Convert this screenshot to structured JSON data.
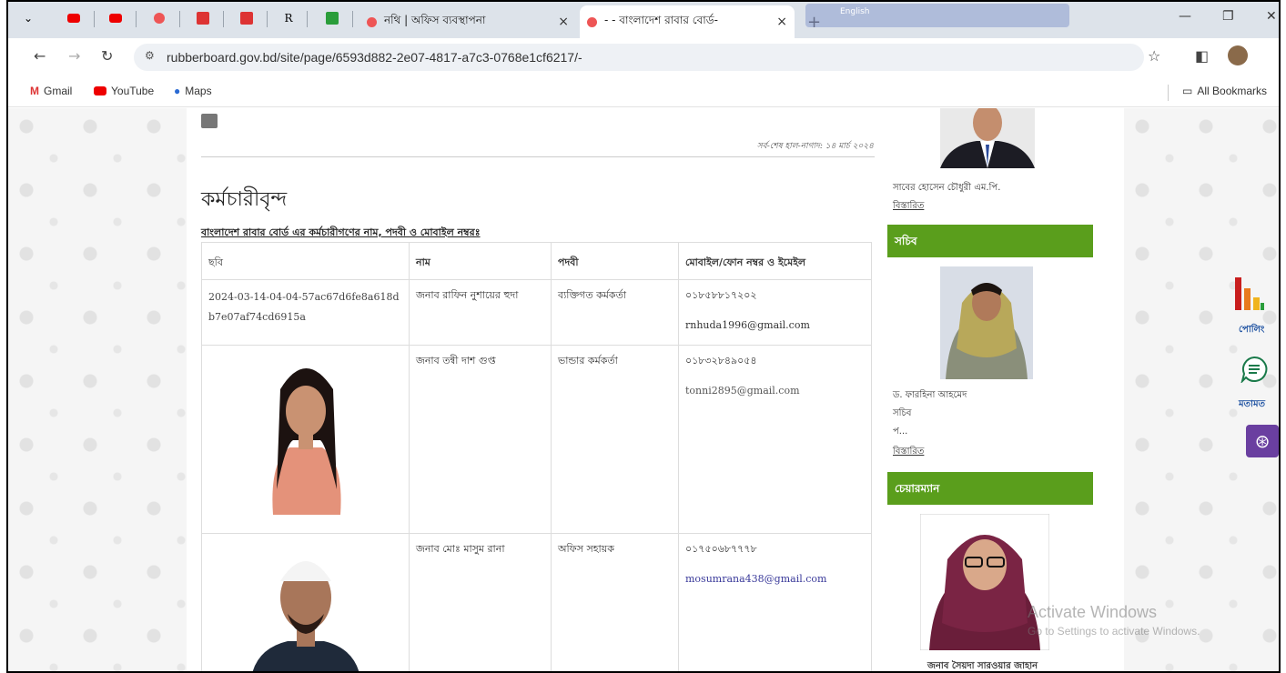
{
  "browser": {
    "tabs": [
      {
        "title": "নথি | অফিস ব্যবস্থাপনা"
      },
      {
        "title": "- - বাংলাদেশ রাবার বোর্ড-"
      }
    ],
    "lang_ext": "English",
    "url": "rubberboard.gov.bd/site/page/6593d882-2e07-4817-a7c3-0768e1cf6217/-",
    "bookmarks": [
      "Gmail",
      "YouTube",
      "Maps"
    ],
    "all_bookmarks": "All Bookmarks"
  },
  "page": {
    "updated": "সর্ব-শেষ হাল-নাগাদ: ১৪ মার্চ ২০২৪",
    "title": "কর্মচারীবৃন্দ",
    "subtitle": "বাংলাদেশ রাবার বোর্ড এর কর্মচারীগণের নাম, পদবী ও মোবাইল নম্বরঃ",
    "table": {
      "headers": [
        "ছবি",
        "নাম",
        "পদবী",
        "মোবাইল/ফোন নম্বর ও ইমেইল"
      ],
      "rows": [
        {
          "photo_alt": "2024-03-14-04-04-57ac67d6fe8a618db7e07af74cd6915a",
          "name": "জনাব রাফিন নুশায়ের হুদা",
          "designation": "ব্যক্তিগত কর্মকর্তা",
          "phone": "০১৮৫৮৮১৭২০২",
          "email": "rnhuda1996@gmail.com"
        },
        {
          "photo_alt": "",
          "name": "জনাব তন্বী দাশ গুপ্ত",
          "designation": "ভান্ডার কর্মকর্তা",
          "phone": "০১৮৩২৮৪৯০৫৪",
          "email": "tonni2895@gmail.com"
        },
        {
          "photo_alt": "",
          "name": "জনাব মোঃ মাসুম রানা",
          "designation": "অফিস সহায়ক",
          "phone": "০১৭৫০৬৮৭৭৭৮",
          "email": "mosumrana438@gmail.com"
        }
      ]
    }
  },
  "sidebar": {
    "minister_name": "সাবের হোসেন চৌধুরী এম.পি.",
    "more1": "বিস্তারিত",
    "secretary_heading": "সচিব",
    "secretary_name": "ড. ফারহিনা আহমেদ",
    "secretary_role": "সচিব",
    "secretary_extra": "প...",
    "more2": "বিস্তারিত",
    "chairman_heading": "চেয়ারম্যান",
    "chairman_name": "জনাব সৈয়দা সারওয়ার জাহান"
  },
  "floaters": {
    "poll": "পোলিং",
    "feedback": "মতামত"
  },
  "watermark": {
    "line1": "Activate Windows",
    "line2": "Go to Settings to activate Windows."
  },
  "colors": {
    "section_green": "#5a9e1c",
    "email_blue": "#3a3a9a"
  }
}
